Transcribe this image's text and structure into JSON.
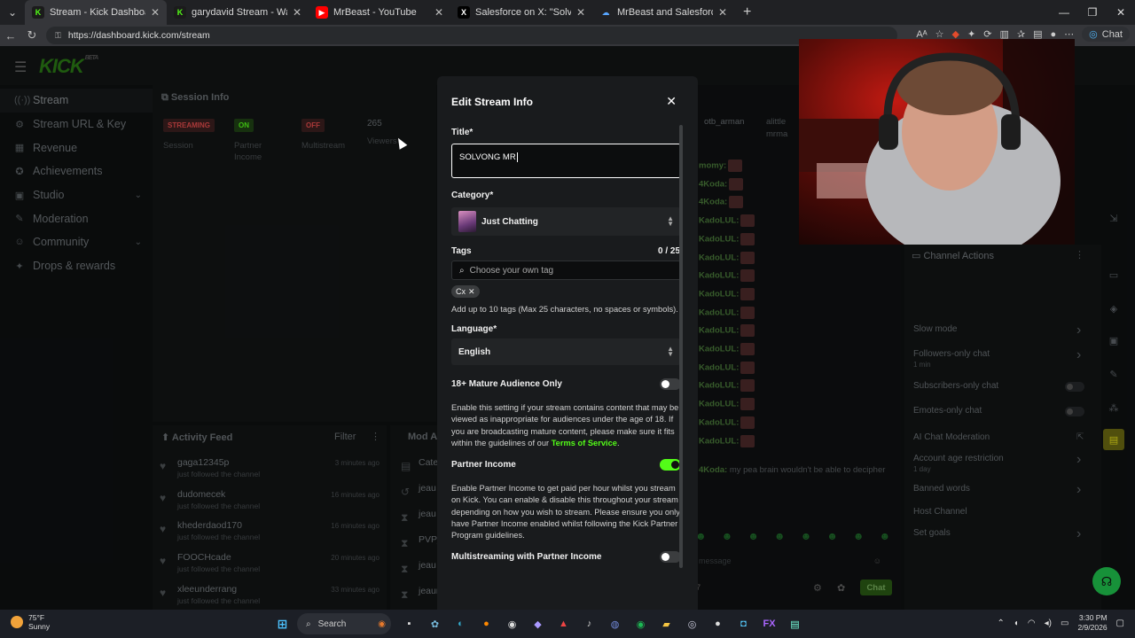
{
  "browser": {
    "tabs": [
      {
        "title": "Stream - Kick Dashboard",
        "active": true,
        "favicon": "K",
        "fav_color": "#53fc18",
        "fav_bg": "#1b1b1b"
      },
      {
        "title": "garydavid Stream - Watch Live",
        "active": false,
        "favicon": "K",
        "fav_color": "#53fc18",
        "fav_bg": "#1b1b1b"
      },
      {
        "title": "MrBeast - YouTube",
        "active": false,
        "favicon": "▶",
        "fav_color": "#fff",
        "fav_bg": "#ff0000"
      },
      {
        "title": "Salesforce on X: \"Solve puzzle. Sla",
        "active": false,
        "favicon": "X",
        "fav_color": "#fff",
        "fav_bg": "#000"
      },
      {
        "title": "MrBeast and Salesforce",
        "active": false,
        "favicon": "☁",
        "fav_color": "#58a6ff",
        "fav_bg": "#202124"
      }
    ],
    "url": "https://dashboard.kick.com/stream",
    "chat_label": "Chat"
  },
  "kick": {
    "sidebar": [
      {
        "label": "Stream",
        "icon": "stream-icon",
        "glyph": "((·))",
        "active": true
      },
      {
        "label": "Stream URL & Key",
        "icon": "key-icon",
        "glyph": "⚙"
      },
      {
        "label": "Revenue",
        "icon": "revenue-icon",
        "glyph": "▦"
      },
      {
        "label": "Achievements",
        "icon": "trophy-icon",
        "glyph": "✪"
      },
      {
        "label": "Studio",
        "icon": "studio-icon",
        "glyph": "▣",
        "expandable": true
      },
      {
        "label": "Moderation",
        "icon": "wrench-icon",
        "glyph": "✎"
      },
      {
        "label": "Community",
        "icon": "community-icon",
        "glyph": "☺",
        "expandable": true
      },
      {
        "label": "Drops & rewards",
        "icon": "gift-icon",
        "glyph": "✦"
      }
    ],
    "session": {
      "header": "Session Info",
      "badges": [
        {
          "text": "STREAMING",
          "sub": "Session",
          "color": "#e34c4c"
        },
        {
          "text": "ON",
          "sub": "Partner Income",
          "color": "#53fc18"
        },
        {
          "text": "OFF",
          "sub": "Multistream",
          "color": "#e34c4c"
        }
      ],
      "viewers_value": "265",
      "viewers_label": "Viewers"
    },
    "activity": {
      "header": "Activity Feed",
      "filter_label": "Filter",
      "items": [
        {
          "name": "gaga12345p",
          "sub": "just followed the channel",
          "time": "3 minutes ago"
        },
        {
          "name": "dudomecek",
          "sub": "just followed the channel",
          "time": "16 minutes ago"
        },
        {
          "name": "khederdaod170",
          "sub": "just followed the channel",
          "time": "16 minutes ago"
        },
        {
          "name": "FOOCHcade",
          "sub": "just followed the channel",
          "time": "20 minutes ago"
        },
        {
          "name": "xleeunderrang",
          "sub": "just followed the channel",
          "time": "33 minutes ago"
        }
      ]
    },
    "mod_actions": {
      "header": "Mod Ac",
      "items": [
        {
          "name": "Cate",
          "time": ""
        },
        {
          "name": "jeau",
          "time": ""
        },
        {
          "name": "jeau",
          "time": ""
        },
        {
          "name": "PVP_",
          "time": ""
        },
        {
          "name": "jeau",
          "time": ""
        },
        {
          "name": "jeauno",
          "time": "20 hours ago"
        }
      ]
    },
    "chat": {
      "top_users": [
        "otb_arman",
        "alittle",
        "mrma"
      ],
      "lines": [
        "momy:",
        "4Koda:",
        "4Koda:",
        "KadoLUL:",
        "KadoLUL:",
        "KadoLUL:",
        "KadoLUL:",
        "KadoLUL:",
        "KadoLUL:",
        "KadoLUL:",
        "KadoLUL:",
        "KadoLUL:",
        "KadoLUL:",
        "KadoLUL:",
        "KadoLUL:",
        "KadoLUL:"
      ],
      "last_speaker": "4Koda:",
      "last_message": "my pea brain wouldn't be able to decipher",
      "message_placeholder": "message",
      "viewer_count": "67",
      "send_label": "Chat"
    },
    "channel_actions": {
      "header": "Channel Actions",
      "rows": [
        {
          "label": "Slow mode",
          "sub": "",
          "control": "arrow"
        },
        {
          "label": "Followers-only chat",
          "sub": "1 min",
          "control": "arrow"
        },
        {
          "label": "Subscribers-only chat",
          "sub": "",
          "control": "toggle"
        },
        {
          "label": "Emotes-only chat",
          "sub": "",
          "control": "toggle"
        },
        {
          "label": "AI Chat Moderation",
          "sub": "",
          "control": "external"
        },
        {
          "label": "Account age restriction",
          "sub": "1 day",
          "control": "arrow"
        },
        {
          "label": "Banned words",
          "sub": "",
          "control": "arrow"
        },
        {
          "label": "Host Channel",
          "sub": "",
          "control": "none"
        },
        {
          "label": "Set goals",
          "sub": "",
          "control": "arrow"
        }
      ]
    }
  },
  "modal": {
    "title": "Edit Stream Info",
    "title_label": "Title*",
    "title_value": "SOLVONG MR",
    "category_label": "Category*",
    "category_value": "Just Chatting",
    "tags_label": "Tags",
    "tags_count": "0 / 25",
    "tags_placeholder": "Choose your own tag",
    "tags": [
      "Cx"
    ],
    "tags_help": "Add up to 10 tags (Max 25 characters, no spaces or symbols).",
    "language_label": "Language*",
    "language_value": "English",
    "mature_label": "18+ Mature Audience Only",
    "mature_on": false,
    "mature_help": "Enable this setting if your stream contains content that may be viewed as inappropriate for audiences under the age of 18. If you are broadcasting mature content, please make sure it fits within the guidelines of our",
    "mature_link": "Terms of Service",
    "partner_label": "Partner Income",
    "partner_on": true,
    "partner_help": "Enable Partner Income to get paid per hour whilst you stream on Kick. You can enable & disable this throughout your stream depending on how you wish to stream. Please ensure you only have Partner Income enabled whilst following the Kick Partner Program guidelines.",
    "multistream_label": "Multistreaming with Partner Income",
    "multistream_on": false
  },
  "taskbar": {
    "temp": "75°F",
    "weather": "Sunny",
    "search_label": "Search",
    "time": "3:30 PM",
    "date": "2/9/2026"
  },
  "colors": {
    "kick_green": "#53fc18",
    "modal_bg": "#191b1d",
    "page_bg": "#0e1011"
  }
}
